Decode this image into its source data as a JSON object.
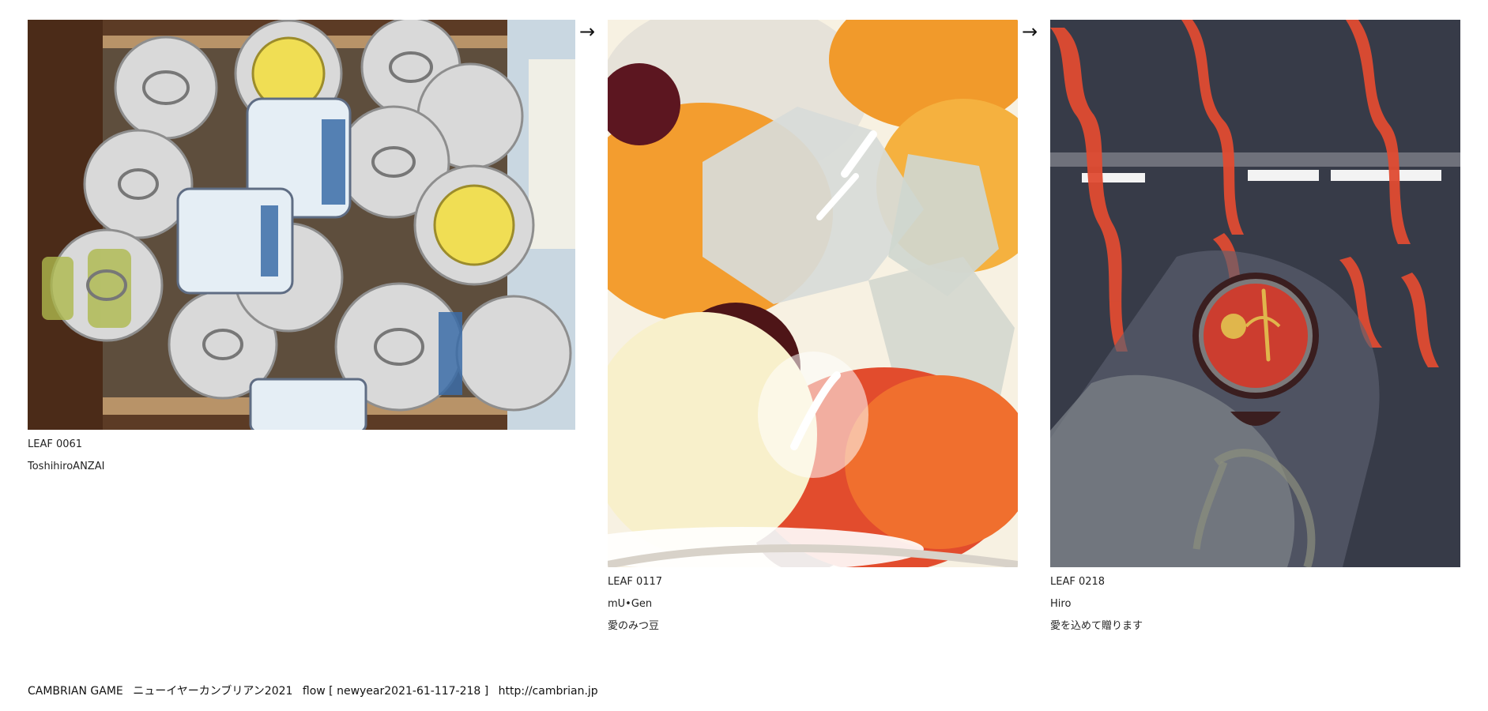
{
  "leaves": [
    {
      "id": "LEAF 0061",
      "author": "ToshihiroANZAI",
      "title": ""
    },
    {
      "id": "LEAF 0117",
      "author": "mU•Gen",
      "title": "愛のみつ豆"
    },
    {
      "id": "LEAF 0218",
      "author": "Hiro",
      "title": "愛を込めて贈ります"
    }
  ],
  "arrows": [
    "→",
    "→"
  ],
  "footer": {
    "brand": "CAMBRIAN GAME",
    "event": "ニューイヤーカンブリアン2021",
    "flow": "flow [ newyear2021-61-117-218 ]",
    "url": "http://cambrian.jp"
  }
}
